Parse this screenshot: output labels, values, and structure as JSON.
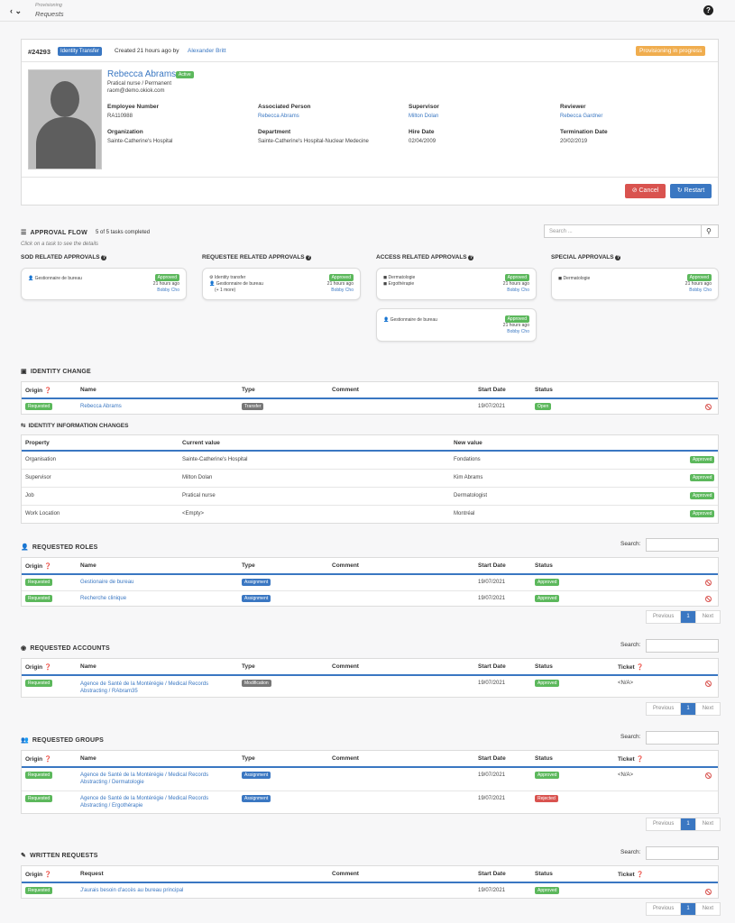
{
  "topbar": {
    "breadcrumb_parent": "Provisioning",
    "breadcrumb_current": "Requests",
    "back_icon": "‹",
    "chevron": "⌄",
    "help": "?"
  },
  "request": {
    "id": "#24293",
    "type_badge": "Identity Transfer",
    "created_text": "Created 21 hours ago by",
    "creator": "Alexander Britt",
    "status": "Provisioning in progress"
  },
  "person": {
    "name": "Rebecca Abrams",
    "active": "Active",
    "job": "Pratical nurse / Permanent",
    "email": "raom@demo.okiok.com",
    "fields": [
      {
        "label": "Employee Number",
        "value": "RA110988",
        "link": false
      },
      {
        "label": "Associated Person",
        "value": "Rebecca Abrams",
        "link": true
      },
      {
        "label": "Supervisor",
        "value": "Milton Dolan",
        "link": true
      },
      {
        "label": "Reviewer",
        "value": "Rebecca Gardner",
        "link": true
      },
      {
        "label": "Organization",
        "value": "Sainte-Catherine's Hospital",
        "link": false
      },
      {
        "label": "Department",
        "value": "Sainte-Catherine's Hospital-Nuclear Medecine",
        "link": false
      },
      {
        "label": "Hire Date",
        "value": "02/04/2009",
        "link": false
      },
      {
        "label": "Termination Date",
        "value": "20/02/2019",
        "link": false
      }
    ]
  },
  "actions": {
    "cancel": "Cancel",
    "restart": "Restart"
  },
  "approval": {
    "title": "APPROVAL FLOW",
    "progress": "5 of 5 tasks completed",
    "hint": "Click on a task to see the details",
    "search_placeholder": "Search ...",
    "groups": [
      {
        "title": "SOD RELATED APPROVALS",
        "cards": [
          {
            "lines": [
              "Gestionnaire de bureau"
            ],
            "status": "Approved",
            "time": "21 hours ago",
            "by": "Bobby Cho"
          }
        ]
      },
      {
        "title": "REQUESTEE RELATED APPROVALS",
        "cards": [
          {
            "lines": [
              "Identity transfer",
              "Gestionnaire de bureau",
              "(+ 1 more)"
            ],
            "status": "Approved",
            "time": "21 hours ago",
            "by": "Bobby Cho"
          }
        ]
      },
      {
        "title": "ACCESS RELATED APPROVALS",
        "cards": [
          {
            "lines": [
              "Dermatologie",
              "Ergothérapie"
            ],
            "status": "Approved",
            "time": "21 hours ago",
            "by": "Bobby Cho"
          },
          {
            "lines": [
              "Gestionnaire de bureau"
            ],
            "status": "Approved",
            "time": "21 hours ago",
            "by": "Bobby Cho"
          }
        ]
      },
      {
        "title": "SPECIAL APPROVALS",
        "cards": [
          {
            "lines": [
              "Dermatologie"
            ],
            "status": "Approved",
            "time": "21 hours ago",
            "by": "Bobby Cho"
          }
        ]
      }
    ]
  },
  "identity_change": {
    "title": "IDENTITY CHANGE",
    "headers": [
      "Origin",
      "Name",
      "Type",
      "Comment",
      "Start Date",
      "Status"
    ],
    "row": {
      "origin": "Requested",
      "name": "Rebecca Abrams",
      "type": "Transfer",
      "comment": "",
      "start": "19/07/2021",
      "status": "Open"
    }
  },
  "info_changes": {
    "title": "IDENTITY INFORMATION CHANGES",
    "headers": [
      "Property",
      "Current value",
      "New value"
    ],
    "rows": [
      {
        "property": "Organisation",
        "current": "Sainte-Catherine's Hospital",
        "new": "Fondations",
        "status": "Approved"
      },
      {
        "property": "Supervisor",
        "current": "Milton Dolan",
        "new": "Kim Abrams",
        "status": "Approved"
      },
      {
        "property": "Job",
        "current": "Pratical nurse",
        "new": "Dermatologist",
        "status": "Approved"
      },
      {
        "property": "Work Location",
        "current": "<Empty>",
        "new": "Montréal",
        "status": "Approved"
      }
    ]
  },
  "roles": {
    "title": "REQUESTED ROLES",
    "search_label": "Search:",
    "headers": [
      "Origin",
      "Name",
      "Type",
      "Comment",
      "Start Date",
      "Status"
    ],
    "rows": [
      {
        "origin": "Requested",
        "name": "Gestionaire de bureau",
        "type": "Assignment",
        "start": "19/07/2021",
        "status": "Approved"
      },
      {
        "origin": "Requested",
        "name": "Recherche clinique",
        "type": "Assignment",
        "start": "19/07/2021",
        "status": "Approved"
      }
    ]
  },
  "accounts": {
    "title": "REQUESTED ACCOUNTS",
    "search_label": "Search:",
    "headers": [
      "Origin",
      "Name",
      "Type",
      "Comment",
      "Start Date",
      "Status",
      "Ticket"
    ],
    "rows": [
      {
        "origin": "Requested",
        "name1": "Agence de Santé de la Montérégie / Medical Records",
        "name2": "Abstracting / RAbram35",
        "type": "Modification",
        "start": "19/07/2021",
        "status": "Approved",
        "ticket": "<N/A>"
      }
    ]
  },
  "groups": {
    "title": "REQUESTED GROUPS",
    "search_label": "Search:",
    "headers": [
      "Origin",
      "Name",
      "Type",
      "Comment",
      "Start Date",
      "Status",
      "Ticket"
    ],
    "rows": [
      {
        "origin": "Requested",
        "name1": "Agence de Santé de la Montérégie / Medical Records",
        "name2": "Abstracting / Dermatologie",
        "type": "Assignment",
        "start": "19/07/2021",
        "status": "Approved",
        "ticket": "<N/A>"
      },
      {
        "origin": "Requested",
        "name1": "Agence de Santé de la Montérégie / Medical Records",
        "name2": "Abstracting / Ergothérapie",
        "type": "Assignment",
        "start": "19/07/2021",
        "status": "Rejected",
        "ticket": ""
      }
    ]
  },
  "written": {
    "title": "WRITTEN REQUESTS",
    "search_label": "Search:",
    "headers": [
      "Origin",
      "Request",
      "Comment",
      "Start Date",
      "Status",
      "Ticket"
    ],
    "rows": [
      {
        "origin": "Requested",
        "request": "J'aurais besoin d'accès au bureau principal",
        "start": "19/07/2021",
        "status": "Approved"
      }
    ]
  },
  "pager": {
    "previous": "Previous",
    "page": "1",
    "next": "Next"
  },
  "colors": {
    "accent": "#3a77c2",
    "approved": "#5cb85c",
    "danger": "#d9534f",
    "warning": "#f0ad4e"
  }
}
